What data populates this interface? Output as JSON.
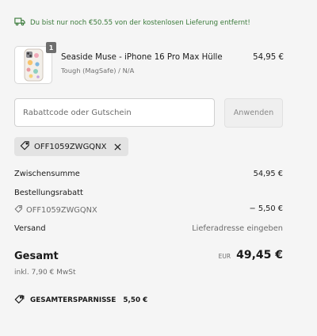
{
  "shipping_banner": {
    "icon": "delivery-truck-icon",
    "text": "Du bist nur noch €50.55 von der kostenlosen Lieferung entfernt!",
    "color": "#3a7a3a"
  },
  "cart_item": {
    "quantity": "1",
    "title": "Seaside Muse - iPhone 16 Pro Max Hülle",
    "variant": "Tough (MagSafe) / N/A",
    "price": "54,95 €"
  },
  "discount": {
    "placeholder": "Rabattcode oder Gutschein",
    "value": "",
    "apply_label": "Anwenden",
    "applied_code": "OFF1059ZWGQNX"
  },
  "summary": {
    "subtotal_label": "Zwischensumme",
    "subtotal_value": "54,95 €",
    "order_discount_label": "Bestellungsrabatt",
    "order_discount_code": "OFF1059ZWGQNX",
    "order_discount_value": "− 5,50 €",
    "shipping_label": "Versand",
    "shipping_value": "Lieferadresse eingeben"
  },
  "total": {
    "label": "Gesamt",
    "currency": "EUR",
    "value": "49,45 €",
    "tax_note": "inkl. 7,90 € MwSt"
  },
  "savings": {
    "label": "GESAMTERSPARNISSE",
    "value": "5,50 €"
  }
}
